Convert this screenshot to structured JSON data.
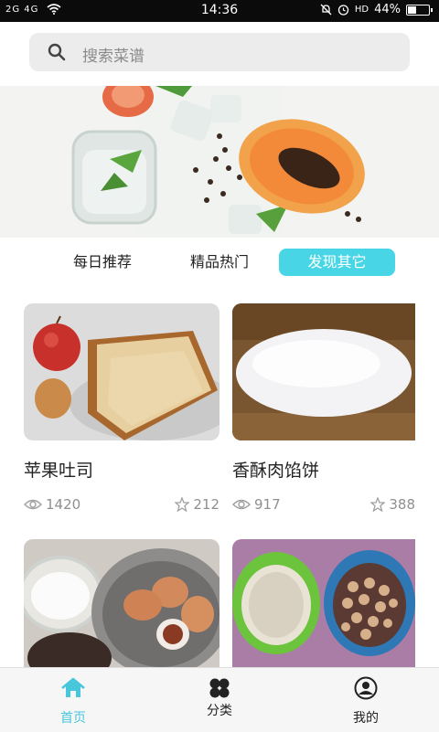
{
  "status_bar": {
    "network": "2G 4G",
    "time": "14:36",
    "volte": "HD",
    "battery_percent": "44%",
    "battery_level": 0.44
  },
  "search": {
    "placeholder": "搜索菜谱"
  },
  "tabs": [
    {
      "label": "每日推荐",
      "active": false
    },
    {
      "label": "精品热门",
      "active": false
    },
    {
      "label": "发现其它",
      "active": true
    }
  ],
  "recipes": [
    {
      "title": "苹果吐司",
      "views": "1420",
      "likes": "212",
      "image": "apple-toast"
    },
    {
      "title": "香酥肉馅饼",
      "views": "917",
      "likes": "388",
      "image": "dough"
    },
    {
      "title": "",
      "views": "",
      "likes": "",
      "image": "eggs-flour"
    },
    {
      "title": "",
      "views": "",
      "likes": "",
      "image": "rice-peanuts"
    }
  ],
  "bottom_nav": [
    {
      "label": "首页",
      "icon": "home-icon",
      "active": true
    },
    {
      "label": "分类",
      "icon": "category-icon",
      "active": false
    },
    {
      "label": "我的",
      "icon": "profile-icon",
      "active": false
    }
  ],
  "colors": {
    "accent": "#48d6e6",
    "nav_active": "#48c6db"
  }
}
